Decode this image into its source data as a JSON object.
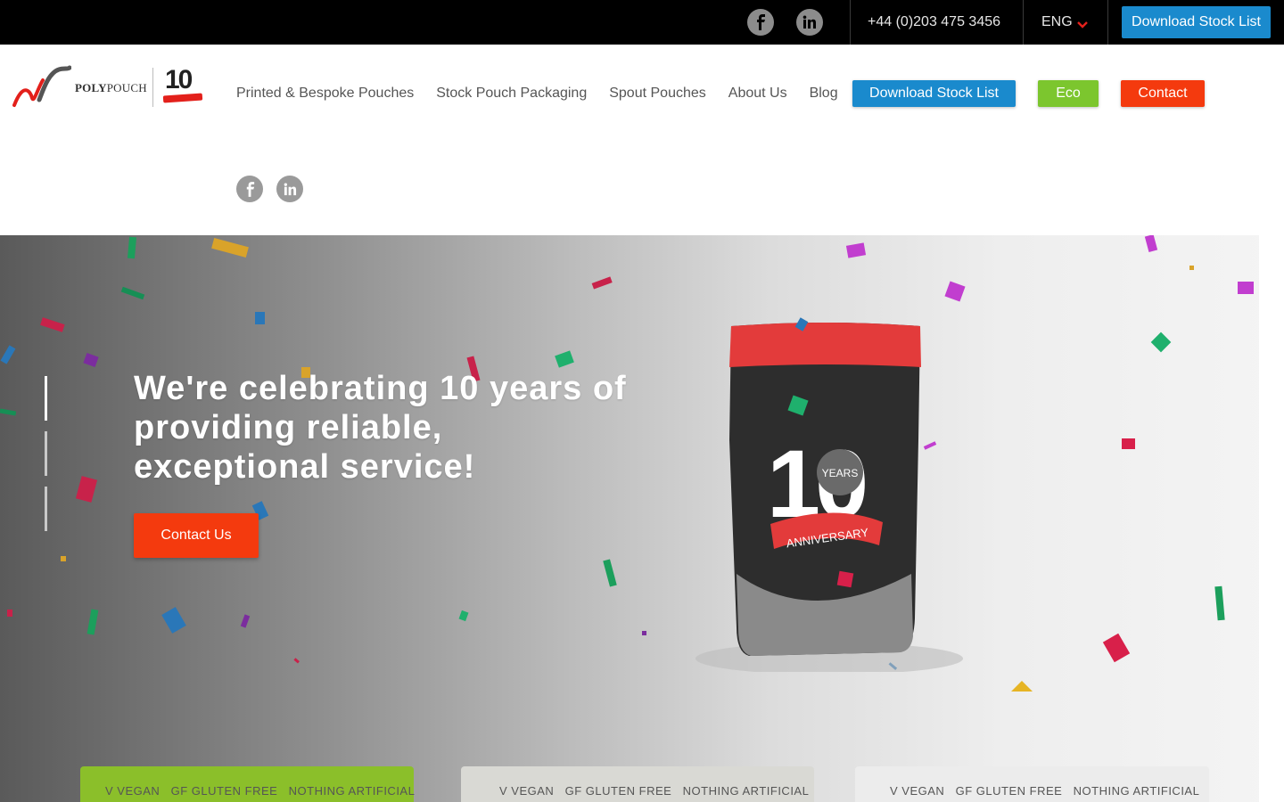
{
  "topbar": {
    "social": [
      {
        "icon": "facebook-icon"
      },
      {
        "icon": "linkedin-icon"
      }
    ],
    "phone": "+44 (0)203 475 3456",
    "language": "ENG",
    "download_label": "Download Stock List",
    "accent": "#1a8acd"
  },
  "header": {
    "logo": {
      "brand_bold": "POLY",
      "brand_rest": "POUCH",
      "anniversary_number": "10"
    },
    "nav": [
      {
        "label": "Printed & Bespoke Pouches"
      },
      {
        "label": "Stock Pouch Packaging"
      },
      {
        "label": "Spout Pouches"
      },
      {
        "label": "About Us"
      },
      {
        "label": "Blog"
      }
    ],
    "buttons": {
      "download": {
        "label": "Download Stock List",
        "color": "#1a8acd"
      },
      "eco": {
        "label": "Eco",
        "color": "#7cc62e"
      },
      "contact": {
        "label": "Contact",
        "color": "#f43a0e"
      }
    },
    "social": [
      {
        "icon": "facebook-icon"
      },
      {
        "icon": "linkedin-icon"
      }
    ]
  },
  "hero": {
    "headline": "We're celebrating 10 years of providing reliable, exceptional service!",
    "cta_label": "Contact Us",
    "cta_color": "#f43a0e",
    "slides_total": 3,
    "active_slide": 1,
    "pouch": {
      "number": "10",
      "years": "YEARS",
      "ribbon": "ANNIVERSARY"
    }
  },
  "product_strip": {
    "items": [
      {
        "labels": [
          "V VEGAN",
          "GF GLUTEN FREE",
          "NOTHING ARTIFICIAL"
        ],
        "color": "#8bbf2a"
      },
      {
        "labels": [
          "V VEGAN",
          "GF GLUTEN FREE",
          "NOTHING ARTIFICIAL"
        ],
        "color": "#d9d9d4"
      },
      {
        "labels": [
          "V VEGAN",
          "GF GLUTEN FREE",
          "NOTHING ARTIFICIAL"
        ],
        "color": "#ececec"
      }
    ]
  }
}
